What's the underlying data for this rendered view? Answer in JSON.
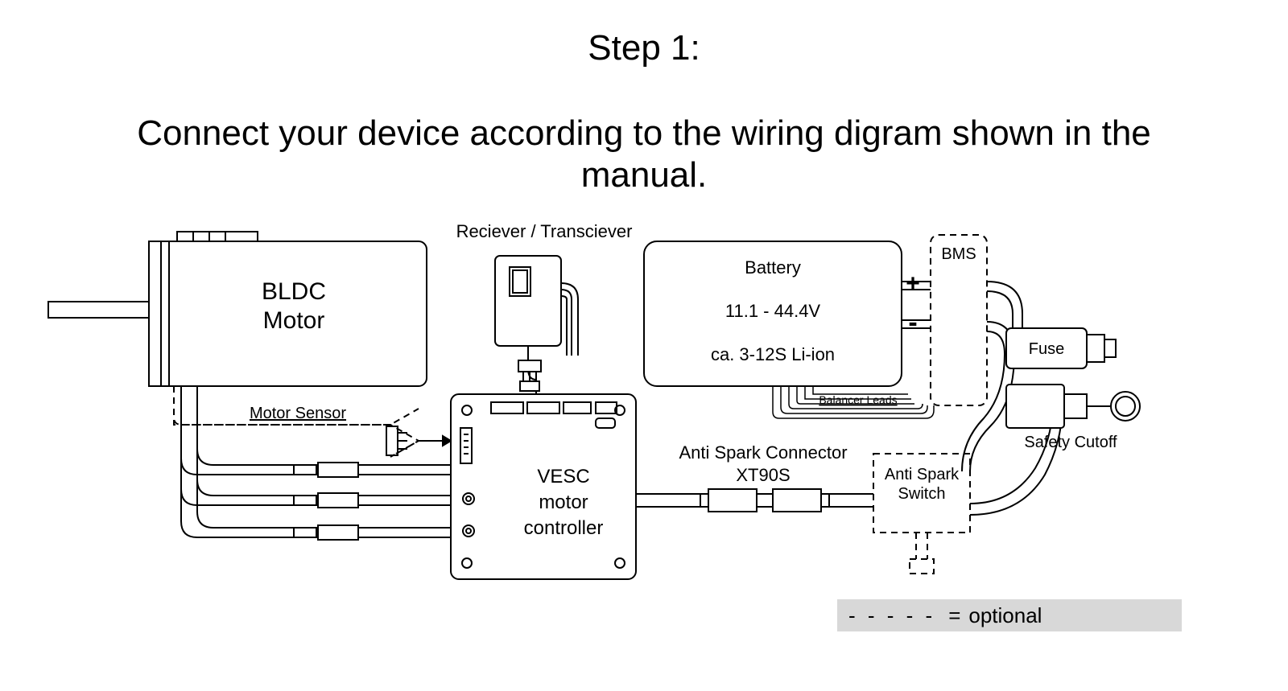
{
  "title": "Step 1:",
  "subtitle": "Connect your device according to the wiring digram shown in the manual.",
  "components": {
    "motor": {
      "line1": "BLDC",
      "line2": "Motor"
    },
    "motor_sensor": "Motor Sensor",
    "receiver": "Reciever / Transciever",
    "vesc": {
      "line1": "VESC",
      "line2": "motor",
      "line3": "controller"
    },
    "antispark_conn": {
      "line1": "Anti Spark Connector",
      "line2": "XT90S"
    },
    "antispark_switch": {
      "line1": "Anti Spark",
      "line2": "Switch"
    },
    "battery": {
      "title": "Battery",
      "voltage": "11.1 - 44.4V",
      "cells": "ca. 3-12S Li-ion",
      "plus": "+",
      "minus": "-"
    },
    "bms": "BMS",
    "balancer": "Balancer Leads",
    "fuse": "Fuse",
    "safety_cutoff": "Safety Cutoff"
  },
  "legend": {
    "dashes": "- - - - -",
    "eq": "=",
    "label": "optional"
  }
}
